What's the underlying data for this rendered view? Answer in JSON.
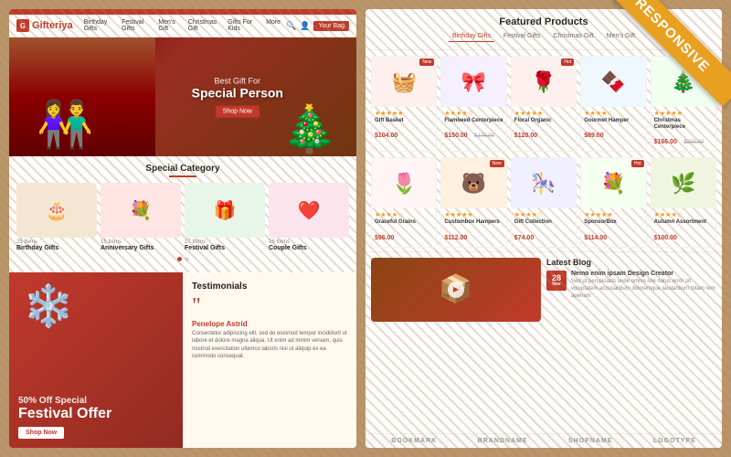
{
  "responsive_label": "RESPONSIVE",
  "left_panel": {
    "top_nav_color": "#c0392b",
    "logo": "Gifteriya",
    "nav_items": [
      "Birthday Gifts",
      "Festival Gifts",
      "Men's Gift",
      "Christmas Gift",
      "Gifts For Kids",
      "More"
    ],
    "cart_label": "Your Bag",
    "hero": {
      "sub_text": "Best Gift For",
      "main_title": "Special Person",
      "btn_label": "Shop Now"
    },
    "special_category": {
      "title": "Special Category",
      "categories": [
        {
          "emoji": "🎂",
          "count": "25 Items",
          "name": "Birthday Gifts",
          "bg": "#f5e6d3"
        },
        {
          "emoji": "💐",
          "count": "15 Items",
          "name": "Anniversary Gifts",
          "bg": "#ffe4e4"
        },
        {
          "emoji": "🎁",
          "count": "17 Items",
          "name": "Festival Gifts",
          "bg": "#e8f5e9"
        },
        {
          "emoji": "❤️",
          "count": "16 Items",
          "name": "Couple Gifts",
          "bg": "#fce4ec"
        }
      ]
    },
    "festival_offer": {
      "percent_text": "50% Off Special",
      "title": "Festival Offer",
      "btn_label": "Shop Now"
    },
    "testimonials": {
      "title": "Testimonials",
      "author": "Penelope Astrid",
      "text": "Consectetur adipiscing elit, sed do eiusmod tempor incididunt ut labore et dolore magna aliqua. Ut enim ad minim veniam, quis nostrud exercitation ullamco laboris nisi ut aliquip ex ea commodo consequat."
    }
  },
  "right_panel": {
    "featured": {
      "title": "Featured Products",
      "tabs": [
        "Birthday Gifts",
        "Festival Gifts",
        "Christmas Gift",
        "Men's Gift"
      ],
      "active_tab": "Birthday Gifts"
    },
    "products_row1": [
      {
        "emoji": "🧺",
        "badge": "New",
        "rating": "★★★★★",
        "name": "Gift Basket",
        "price": "$104.00",
        "bg": "#fff0f0"
      },
      {
        "emoji": "🎀",
        "badge": "",
        "rating": "★★★★☆",
        "name": "Flambeed Centerpiece",
        "price": "$150.00",
        "old": "$179.00",
        "bg": "#f5f0ff"
      },
      {
        "emoji": "🌹",
        "badge": "Hot",
        "rating": "★★★★★",
        "name": "Floral Organic",
        "price": "$120.00",
        "bg": "#fff0f0"
      },
      {
        "emoji": "🍫",
        "badge": "",
        "rating": "★★★★☆",
        "name": "Gourmet Hamper",
        "price": "$89.00",
        "bg": "#f0f8ff"
      },
      {
        "emoji": "🎄",
        "badge": "Sale",
        "rating": "★★★★★",
        "name": "Christmas Centerpiece",
        "price": "$166.00",
        "old": "$200.00",
        "bg": "#f0fff0"
      }
    ],
    "products_row2": [
      {
        "emoji": "🌷",
        "badge": "",
        "rating": "★★★★☆",
        "name": "Graceful Grains",
        "price": "$96.00",
        "bg": "#fff5f5"
      },
      {
        "emoji": "🐻",
        "badge": "New",
        "rating": "★★★★★",
        "name": "Custombox Hampers",
        "price": "$112.00",
        "bg": "#fff0e0"
      },
      {
        "emoji": "🎠",
        "badge": "",
        "rating": "★★★★☆",
        "name": "Gift Collection",
        "price": "$74.00",
        "bg": "#f0f0ff"
      },
      {
        "emoji": "💐",
        "badge": "Hot",
        "rating": "★★★★★",
        "name": "SponsorBox",
        "price": "$114.00",
        "bg": "#f5fff0"
      },
      {
        "emoji": "🌿",
        "badge": "",
        "rating": "★★★★☆",
        "name": "Autumn Assortment",
        "price": "$100.00",
        "bg": "#f0f5e0"
      }
    ],
    "blog": {
      "title": "Latest Blog",
      "items": [
        {
          "day": "28",
          "month": "Nov",
          "title": "Nemo enim ipsam Design Creator",
          "desc": "Sed ut perspiciatis unde omnis iste natus error sit voluptatem accusantium doloremque laudantium totam rem aperiam"
        }
      ]
    },
    "brands": [
      "BOOKMARK",
      "BRANDNAME",
      "SHOPNAME",
      "LOGOTYPE"
    ]
  }
}
